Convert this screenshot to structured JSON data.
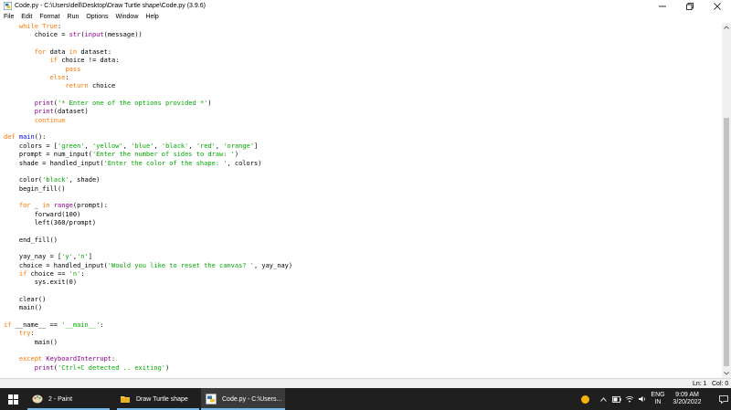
{
  "window": {
    "title": "Code.py - C:\\Users\\dell\\Desktop\\Draw Turtle shape\\Code.py (3.9.6)"
  },
  "menu": {
    "items": [
      "File",
      "Edit",
      "Format",
      "Run",
      "Options",
      "Window",
      "Help"
    ]
  },
  "editor": {
    "lines": [
      [
        {
          "t": "    "
        },
        {
          "t": "while",
          "c": "kw"
        },
        {
          "t": " "
        },
        {
          "t": "True",
          "c": "kw"
        },
        {
          "t": ":"
        }
      ],
      [
        {
          "t": "        choice = "
        },
        {
          "t": "str",
          "c": "bi"
        },
        {
          "t": "("
        },
        {
          "t": "input",
          "c": "bi"
        },
        {
          "t": "(message))"
        }
      ],
      [],
      [
        {
          "t": "        "
        },
        {
          "t": "for",
          "c": "kw"
        },
        {
          "t": " data "
        },
        {
          "t": "in",
          "c": "kw"
        },
        {
          "t": " dataset:"
        }
      ],
      [
        {
          "t": "            "
        },
        {
          "t": "if",
          "c": "kw"
        },
        {
          "t": " choice != data:"
        }
      ],
      [
        {
          "t": "                "
        },
        {
          "t": "pass",
          "c": "kw"
        }
      ],
      [
        {
          "t": "            "
        },
        {
          "t": "else",
          "c": "kw"
        },
        {
          "t": ":"
        }
      ],
      [
        {
          "t": "                "
        },
        {
          "t": "return",
          "c": "kw"
        },
        {
          "t": " choice"
        }
      ],
      [],
      [
        {
          "t": "        "
        },
        {
          "t": "print",
          "c": "bi"
        },
        {
          "t": "("
        },
        {
          "t": "'* Enter one of the options provided *'",
          "c": "str"
        },
        {
          "t": ")"
        }
      ],
      [
        {
          "t": "        "
        },
        {
          "t": "print",
          "c": "bi"
        },
        {
          "t": "(dataset)"
        }
      ],
      [
        {
          "t": "        "
        },
        {
          "t": "continue",
          "c": "kw"
        }
      ],
      [],
      [
        {
          "t": "def",
          "c": "kw"
        },
        {
          "t": " "
        },
        {
          "t": "main",
          "c": "df"
        },
        {
          "t": "():"
        }
      ],
      [
        {
          "t": "    colors = ["
        },
        {
          "t": "'green'",
          "c": "str"
        },
        {
          "t": ", "
        },
        {
          "t": "'yellow'",
          "c": "str"
        },
        {
          "t": ", "
        },
        {
          "t": "'blue'",
          "c": "str"
        },
        {
          "t": ", "
        },
        {
          "t": "'black'",
          "c": "str"
        },
        {
          "t": ", "
        },
        {
          "t": "'red'",
          "c": "str"
        },
        {
          "t": ", "
        },
        {
          "t": "'orange'",
          "c": "str"
        },
        {
          "t": "]"
        }
      ],
      [
        {
          "t": "    prompt = num_input("
        },
        {
          "t": "'Enter the number of sides to draw: '",
          "c": "str"
        },
        {
          "t": ")"
        }
      ],
      [
        {
          "t": "    shade = handled_input("
        },
        {
          "t": "'Enter the color of the shape: '",
          "c": "str"
        },
        {
          "t": ", colors)"
        }
      ],
      [],
      [
        {
          "t": "    color("
        },
        {
          "t": "'black'",
          "c": "str"
        },
        {
          "t": ", shade)"
        }
      ],
      [
        {
          "t": "    begin_fill()"
        }
      ],
      [],
      [
        {
          "t": "    "
        },
        {
          "t": "for",
          "c": "kw"
        },
        {
          "t": " _ "
        },
        {
          "t": "in",
          "c": "kw"
        },
        {
          "t": " "
        },
        {
          "t": "range",
          "c": "bi"
        },
        {
          "t": "(prompt):"
        }
      ],
      [
        {
          "t": "        forward(100)"
        }
      ],
      [
        {
          "t": "        left(360/prompt)"
        }
      ],
      [],
      [
        {
          "t": "    end_fill()"
        }
      ],
      [],
      [
        {
          "t": "    yay_nay = ["
        },
        {
          "t": "'y'",
          "c": "str"
        },
        {
          "t": ","
        },
        {
          "t": "'n'",
          "c": "str"
        },
        {
          "t": "]"
        }
      ],
      [
        {
          "t": "    choice = handled_input("
        },
        {
          "t": "'Would you like to reset the canvas? '",
          "c": "str"
        },
        {
          "t": ", yay_nay)"
        }
      ],
      [
        {
          "t": "    "
        },
        {
          "t": "if",
          "c": "kw"
        },
        {
          "t": " choice == "
        },
        {
          "t": "'n'",
          "c": "str"
        },
        {
          "t": ":"
        }
      ],
      [
        {
          "t": "        sys.exit(0)"
        }
      ],
      [],
      [
        {
          "t": "    clear()"
        }
      ],
      [
        {
          "t": "    main()"
        }
      ],
      [],
      [
        {
          "t": "if",
          "c": "kw"
        },
        {
          "t": " __name__ == "
        },
        {
          "t": "'__main__'",
          "c": "str"
        },
        {
          "t": ":"
        }
      ],
      [
        {
          "t": "    "
        },
        {
          "t": "try",
          "c": "kw"
        },
        {
          "t": ":"
        }
      ],
      [
        {
          "t": "        main()"
        }
      ],
      [],
      [
        {
          "t": "    "
        },
        {
          "t": "except",
          "c": "kw"
        },
        {
          "t": " "
        },
        {
          "t": "KeyboardInterrupt",
          "c": "bi"
        },
        {
          "t": ":"
        }
      ],
      [
        {
          "t": "        "
        },
        {
          "t": "print",
          "c": "bi"
        },
        {
          "t": "("
        },
        {
          "t": "'Ctrl+C detected .. exiting'",
          "c": "str"
        },
        {
          "t": ")"
        }
      ]
    ]
  },
  "statusbar": {
    "line": "Ln: 1",
    "col": "Col: 0"
  },
  "taskbar": {
    "items": [
      {
        "label": "2 - Paint",
        "icon": "paint-icon",
        "active": false
      },
      {
        "label": "Draw Turtle shape",
        "icon": "folder-icon",
        "active": false
      },
      {
        "label": "Code.py - C:\\Users...",
        "icon": "python-idle-icon",
        "active": true
      }
    ],
    "tray": {
      "lang_top": "ENG",
      "lang_bottom": "IN",
      "time": "9:09 AM",
      "date": "3/20/2022"
    }
  },
  "colors": {
    "keyword": "#ff7700",
    "string": "#00aa00",
    "builtin": "#900090",
    "definition": "#0000ff",
    "taskbar": "#1f1f1f",
    "taskbar_accent": "#76b9ed"
  }
}
